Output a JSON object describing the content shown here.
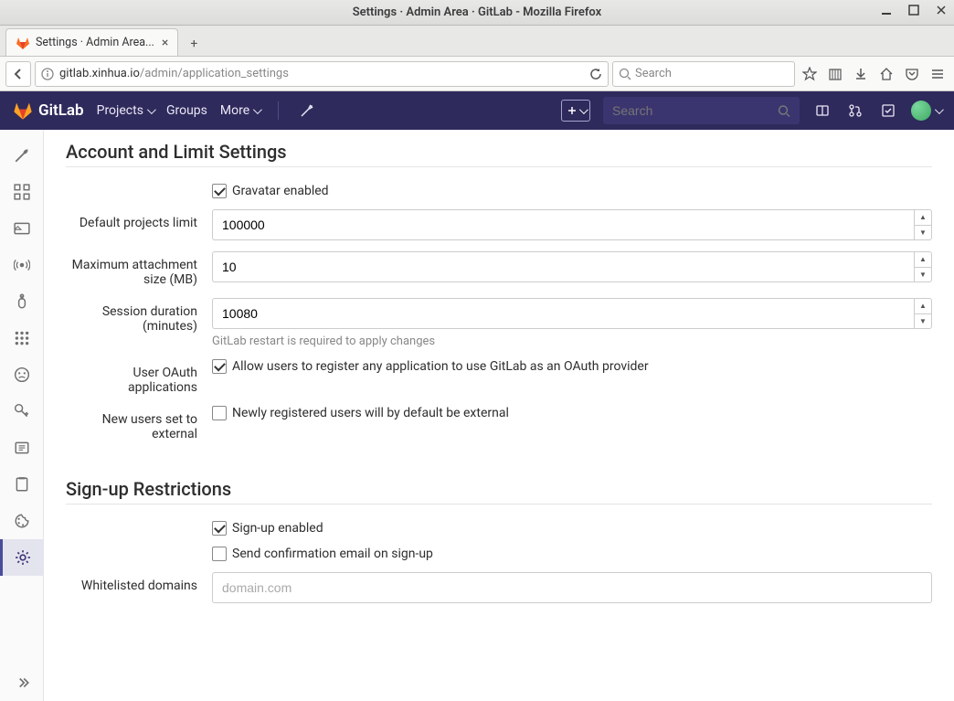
{
  "os": {
    "title": "Settings · Admin Area · GitLab - Mozilla Firefox"
  },
  "browser": {
    "tab_title": "Settings · Admin Area...",
    "url_host": "gitlab.xinhua.io",
    "url_path": "/admin/application_settings",
    "search_placeholder": "Search"
  },
  "topnav": {
    "brand": "GitLab",
    "projects": "Projects",
    "groups": "Groups",
    "more": "More",
    "search_placeholder": "Search"
  },
  "sections": {
    "account": {
      "title": "Account and Limit Settings",
      "gravatar_label": "Gravatar enabled",
      "default_projects_limit_label": "Default projects limit",
      "default_projects_limit_value": "100000",
      "max_attachment_label": "Maximum attachment size (MB)",
      "max_attachment_value": "10",
      "session_duration_label": "Session duration (minutes)",
      "session_duration_value": "10080",
      "session_duration_help": "GitLab restart is required to apply changes",
      "user_oauth_label": "User OAuth applications",
      "user_oauth_check_label": "Allow users to register any application to use GitLab as an OAuth provider",
      "new_users_external_label": "New users set to external",
      "new_users_external_check_label": "Newly registered users will by default be external"
    },
    "signup": {
      "title": "Sign-up Restrictions",
      "signup_enabled_label": "Sign-up enabled",
      "send_confirmation_label": "Send confirmation email on sign-up",
      "whitelisted_domains_label": "Whitelisted domains",
      "whitelisted_domains_placeholder": "domain.com"
    }
  }
}
